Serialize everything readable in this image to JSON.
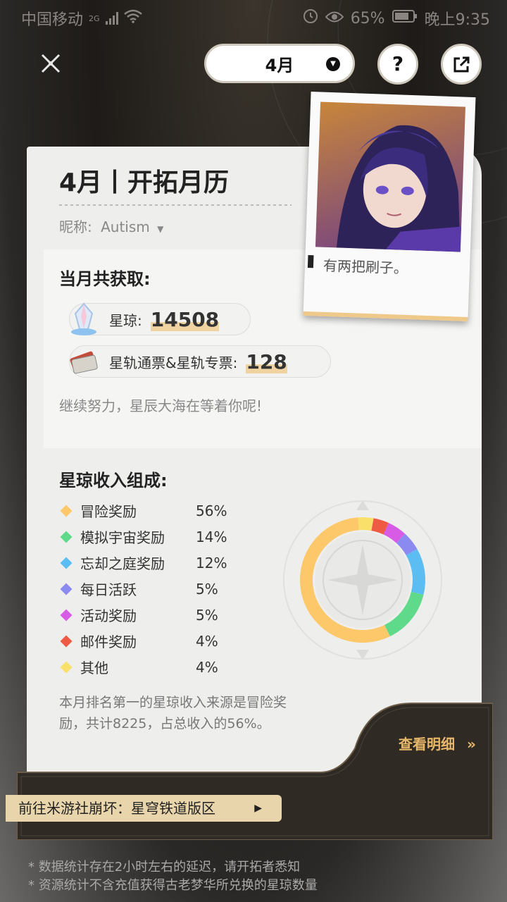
{
  "status_bar": {
    "carrier": "中国移动",
    "network": "2G",
    "battery": "65%",
    "time": "晚上9:35"
  },
  "header": {
    "month": "4月"
  },
  "card": {
    "title": "4月丨开拓月历",
    "nickname_label": "昵称:",
    "nickname": "Autism",
    "gain_title": "当月共获取:",
    "stellar_jade_label": "星琼:",
    "stellar_jade": "14508",
    "passes_label": "星轨通票&星轨专票:",
    "passes": "128",
    "encourage": "继续努力，星辰大海在等着你呢!",
    "income_title": "星琼收入组成:",
    "summary": "本月排名第一的星琼收入来源是冒险奖励，共计8225，占总收入的56%。"
  },
  "chart_data": {
    "type": "pie",
    "series": [
      {
        "name": "冒险奖励",
        "value": 56,
        "label": "56%",
        "color": "#fdc86a"
      },
      {
        "name": "模拟宇宙奖励",
        "value": 14,
        "label": "14%",
        "color": "#5fd98a"
      },
      {
        "name": "忘却之庭奖励",
        "value": 12,
        "label": "12%",
        "color": "#5bbdf2"
      },
      {
        "name": "每日活跃",
        "value": 5,
        "label": "5%",
        "color": "#8b8af0"
      },
      {
        "name": "活动奖励",
        "value": 5,
        "label": "5%",
        "color": "#d85be6"
      },
      {
        "name": "邮件奖励",
        "value": 4,
        "label": "4%",
        "color": "#ef5a44"
      },
      {
        "name": "其他",
        "value": 4,
        "label": "4%",
        "color": "#f8e06a"
      }
    ]
  },
  "polaroid": {
    "caption": "有两把刷子。"
  },
  "actions": {
    "detail": "查看明细",
    "goto": "前往米游社崩坏：星穹铁道版区"
  },
  "footnotes": [
    "* 数据统计存在2小时左右的延迟，请开拓者悉知",
    "* 资源统计不含充值获得古老梦华所兑换的星琼数量"
  ]
}
